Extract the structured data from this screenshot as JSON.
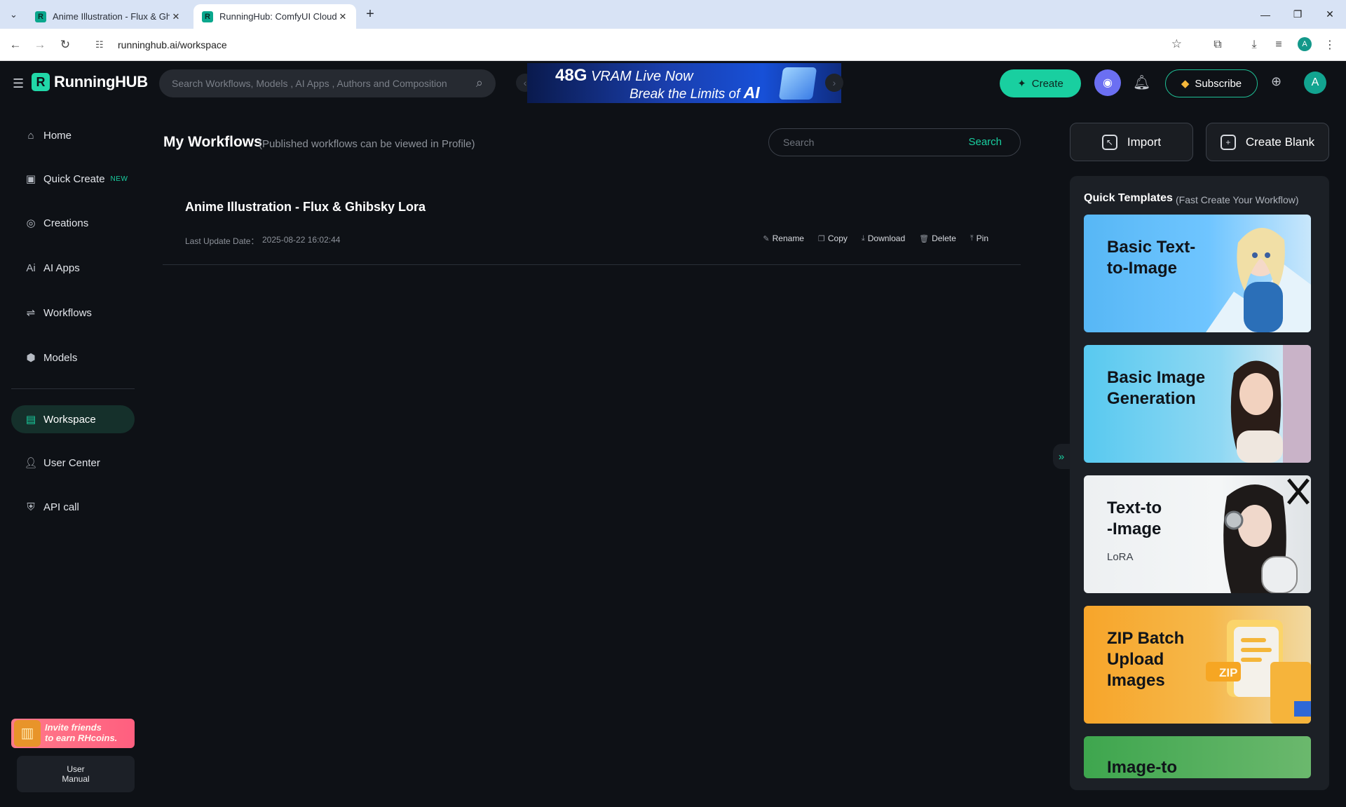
{
  "browser": {
    "tabs": [
      {
        "title": "Anime Illustration - Flux & Ghib",
        "active": false
      },
      {
        "title": "RunningHub: ComfyUI Cloud, C",
        "active": true
      }
    ],
    "url": "runninghub.ai/workspace",
    "profile_initial": "A"
  },
  "header": {
    "logo_text": "RunningHUB",
    "search_placeholder": "Search Workflows, Models , AI Apps , Authors and Composition",
    "banner": {
      "line1_strong": "48G",
      "line1": "VRAM Live Now",
      "line2": "Break the Limits of",
      "line2_strong": "AI"
    },
    "create_label": "Create",
    "subscribe_label": "Subscribe",
    "avatar_initial": "A"
  },
  "sidebar": {
    "items": [
      {
        "label": "Home",
        "icon": "home-icon"
      },
      {
        "label": "Quick Create",
        "icon": "quick-create-icon",
        "badge": "NEW"
      },
      {
        "label": "Creations",
        "icon": "creations-icon"
      },
      {
        "label": "AI Apps",
        "icon": "ai-apps-icon"
      },
      {
        "label": "Workflows",
        "icon": "workflows-icon"
      },
      {
        "label": "Models",
        "icon": "models-icon"
      },
      {
        "label": "Workspace",
        "icon": "workspace-icon",
        "active": true
      },
      {
        "label": "User Center",
        "icon": "user-icon"
      },
      {
        "label": "API call",
        "icon": "api-icon"
      }
    ],
    "invite": {
      "line1": "Invite friends",
      "line2": "to earn RHcoins."
    },
    "manual": {
      "line1": "User",
      "line2": "Manual"
    }
  },
  "main": {
    "title": "My Workflows",
    "subtitle": "(Published workflows can be viewed in Profile)",
    "search_placeholder": "Search",
    "search_button": "Search",
    "workflows": [
      {
        "name": "Anime Illustration - Flux & Ghibsky Lora",
        "date_label": "Last Update Date：",
        "date": "2025-08-22 16:02:44",
        "actions": [
          "Rename",
          "Copy",
          "Download",
          "Delete",
          "Pin"
        ]
      }
    ]
  },
  "right_panel": {
    "import_label": "Import",
    "create_blank_label": "Create Blank",
    "templates_title": "Quick Templates",
    "templates_subtitle": "(Fast Create Your Workflow)",
    "templates": [
      {
        "line1": "Basic Text-",
        "line2": "to-Image",
        "sub": ""
      },
      {
        "line1": "Basic Image",
        "line2": "Generation",
        "sub": ""
      },
      {
        "line1": "Text-to",
        "line2": "-Image",
        "sub": "LoRA"
      },
      {
        "line1": "ZIP Batch",
        "line2": "Upload",
        "line3": "Images",
        "sub": ""
      },
      {
        "line1": "Image-to",
        "line2": "",
        "sub": ""
      }
    ],
    "zip_badge": "ZIP"
  },
  "colors": {
    "accent": "#19cfa0",
    "background": "#0e1116",
    "panel": "#1c2026"
  }
}
